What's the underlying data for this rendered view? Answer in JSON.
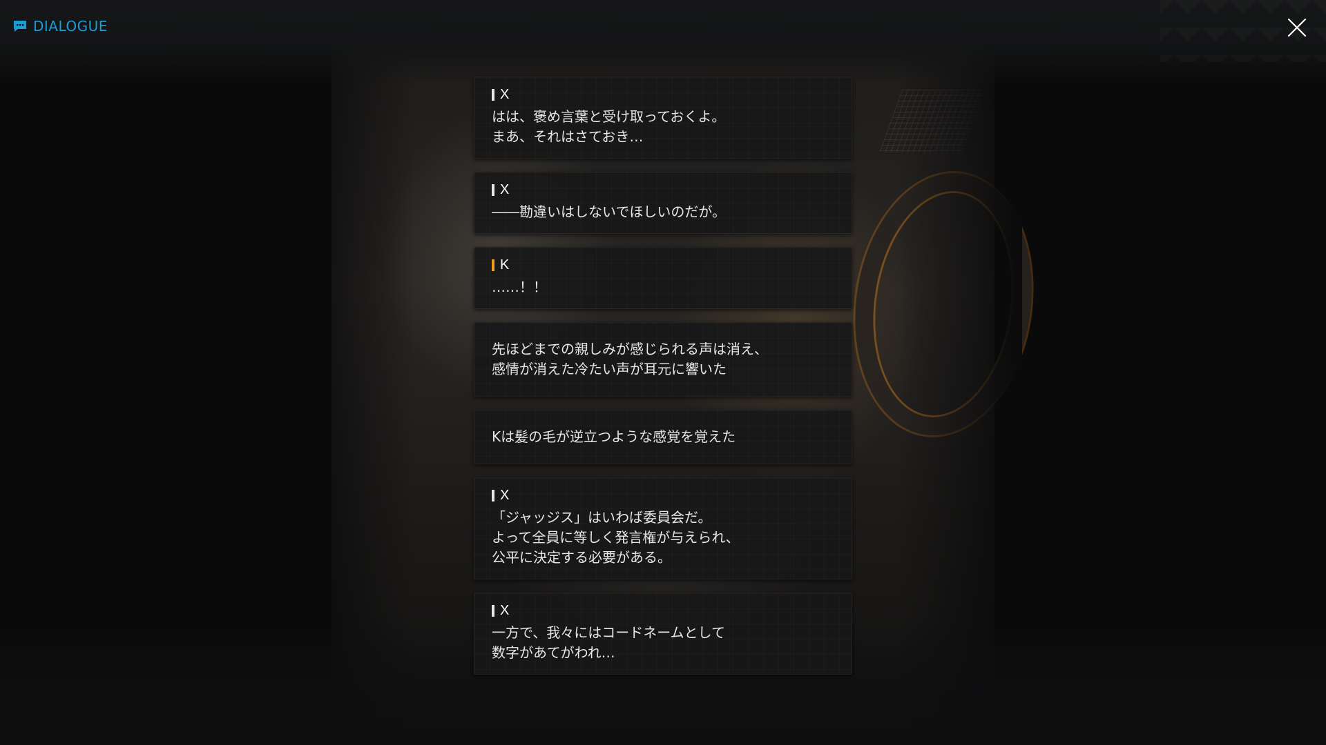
{
  "header": {
    "title": "DIALOGUE",
    "title_icon": "chat-bubble-icon",
    "close_icon": "close-icon",
    "accent_color": "#1d9bd6"
  },
  "dialogue": [
    {
      "type": "speech",
      "speaker": "X",
      "marker_color": "#e8e8e8",
      "lines": [
        "はは、褒め言葉と受け取っておくよ。",
        "まあ、それはさておき…"
      ]
    },
    {
      "type": "speech",
      "speaker": "X",
      "marker_color": "#e8e8e8",
      "lines": [
        "――勘違いはしないでほしいのだが。"
      ]
    },
    {
      "type": "speech",
      "speaker": "K",
      "marker_color": "#f0a020",
      "lines": [
        "……！！"
      ]
    },
    {
      "type": "narration",
      "lines": [
        "先ほどまでの親しみが感じられる声は消え、",
        "感情が消えた冷たい声が耳元に響いた"
      ]
    },
    {
      "type": "narration",
      "lines": [
        "Kは髪の毛が逆立つような感覚を覚えた"
      ]
    },
    {
      "type": "speech",
      "speaker": "X",
      "marker_color": "#e8e8e8",
      "lines": [
        "「ジャッジス」はいわば委員会だ。",
        "よって全員に等しく発言権が与えられ、",
        "公平に決定する必要がある。"
      ]
    },
    {
      "type": "speech",
      "speaker": "X",
      "marker_color": "#e8e8e8",
      "lines": [
        "一方で、我々にはコードネームとして",
        "数字があてがわれ…"
      ]
    }
  ]
}
